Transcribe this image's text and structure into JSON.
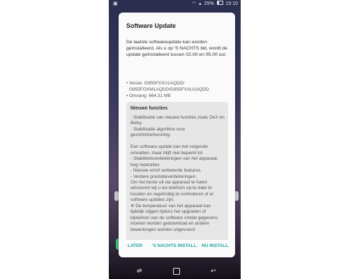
{
  "statusbar": {
    "notification_icon": "notification-icon",
    "wifi_icon": "wifi-icon",
    "signal_icon": "signal-icon",
    "battery": "25%",
    "time": "15:10"
  },
  "dialog": {
    "title": "Software Update",
    "intro": "De laatste softwareupdate kan worden geïnstalleerd. Als u op 'S NACHTS tikt, wordt de update geïnstalleerd tussen 02.00 en 05.00 uur.",
    "info": [
      "• Versie: G955FXXU1AQDD/",
      "G955FOXM1AQDD/G955FXXU1AQDD",
      "• Omvang: 664,31 MB"
    ],
    "notes_title": "Nieuwe functies",
    "notes_body": "· Stabilisatie van nieuwe functies zoals DeX en Bixby.\n· Stabilisatie algoritme voor gezichtsherkenning.\n\nEen software update kan het volgende omvatten, maar blijft niet beperkt tot\n - Stabiliteitsverbeteringen van het apparaat, bug reparaties.\n - Nieuwe en/of verbeterde features.\n - Verdere prestatieverbeteringen.\nOm het beste uit uw apparaat te halen adviseren wij u uw telefoon up-to-date te houden en regelmatig te controleren of er software updates zijn.\n※ De temperatuur van het apparaat kan tijdelijk stijgen tijdens het upgraden of bijwerken van de software omdat gegevens moeten worden gedownload en andere bewerkingen worden uitgevoerd.",
    "buttons": {
      "later": "LATER",
      "night": "'S NACHTS INSTALL.",
      "now": "NU INSTALL."
    }
  },
  "navbar": {
    "recent_icon": "recent-apps-icon",
    "home_icon": "home-icon",
    "back_icon": "back-icon"
  },
  "colors": {
    "accent": "#1aa7a1",
    "dialog_bg": "#fafafa",
    "notes_bg": "#e6e6e6"
  }
}
